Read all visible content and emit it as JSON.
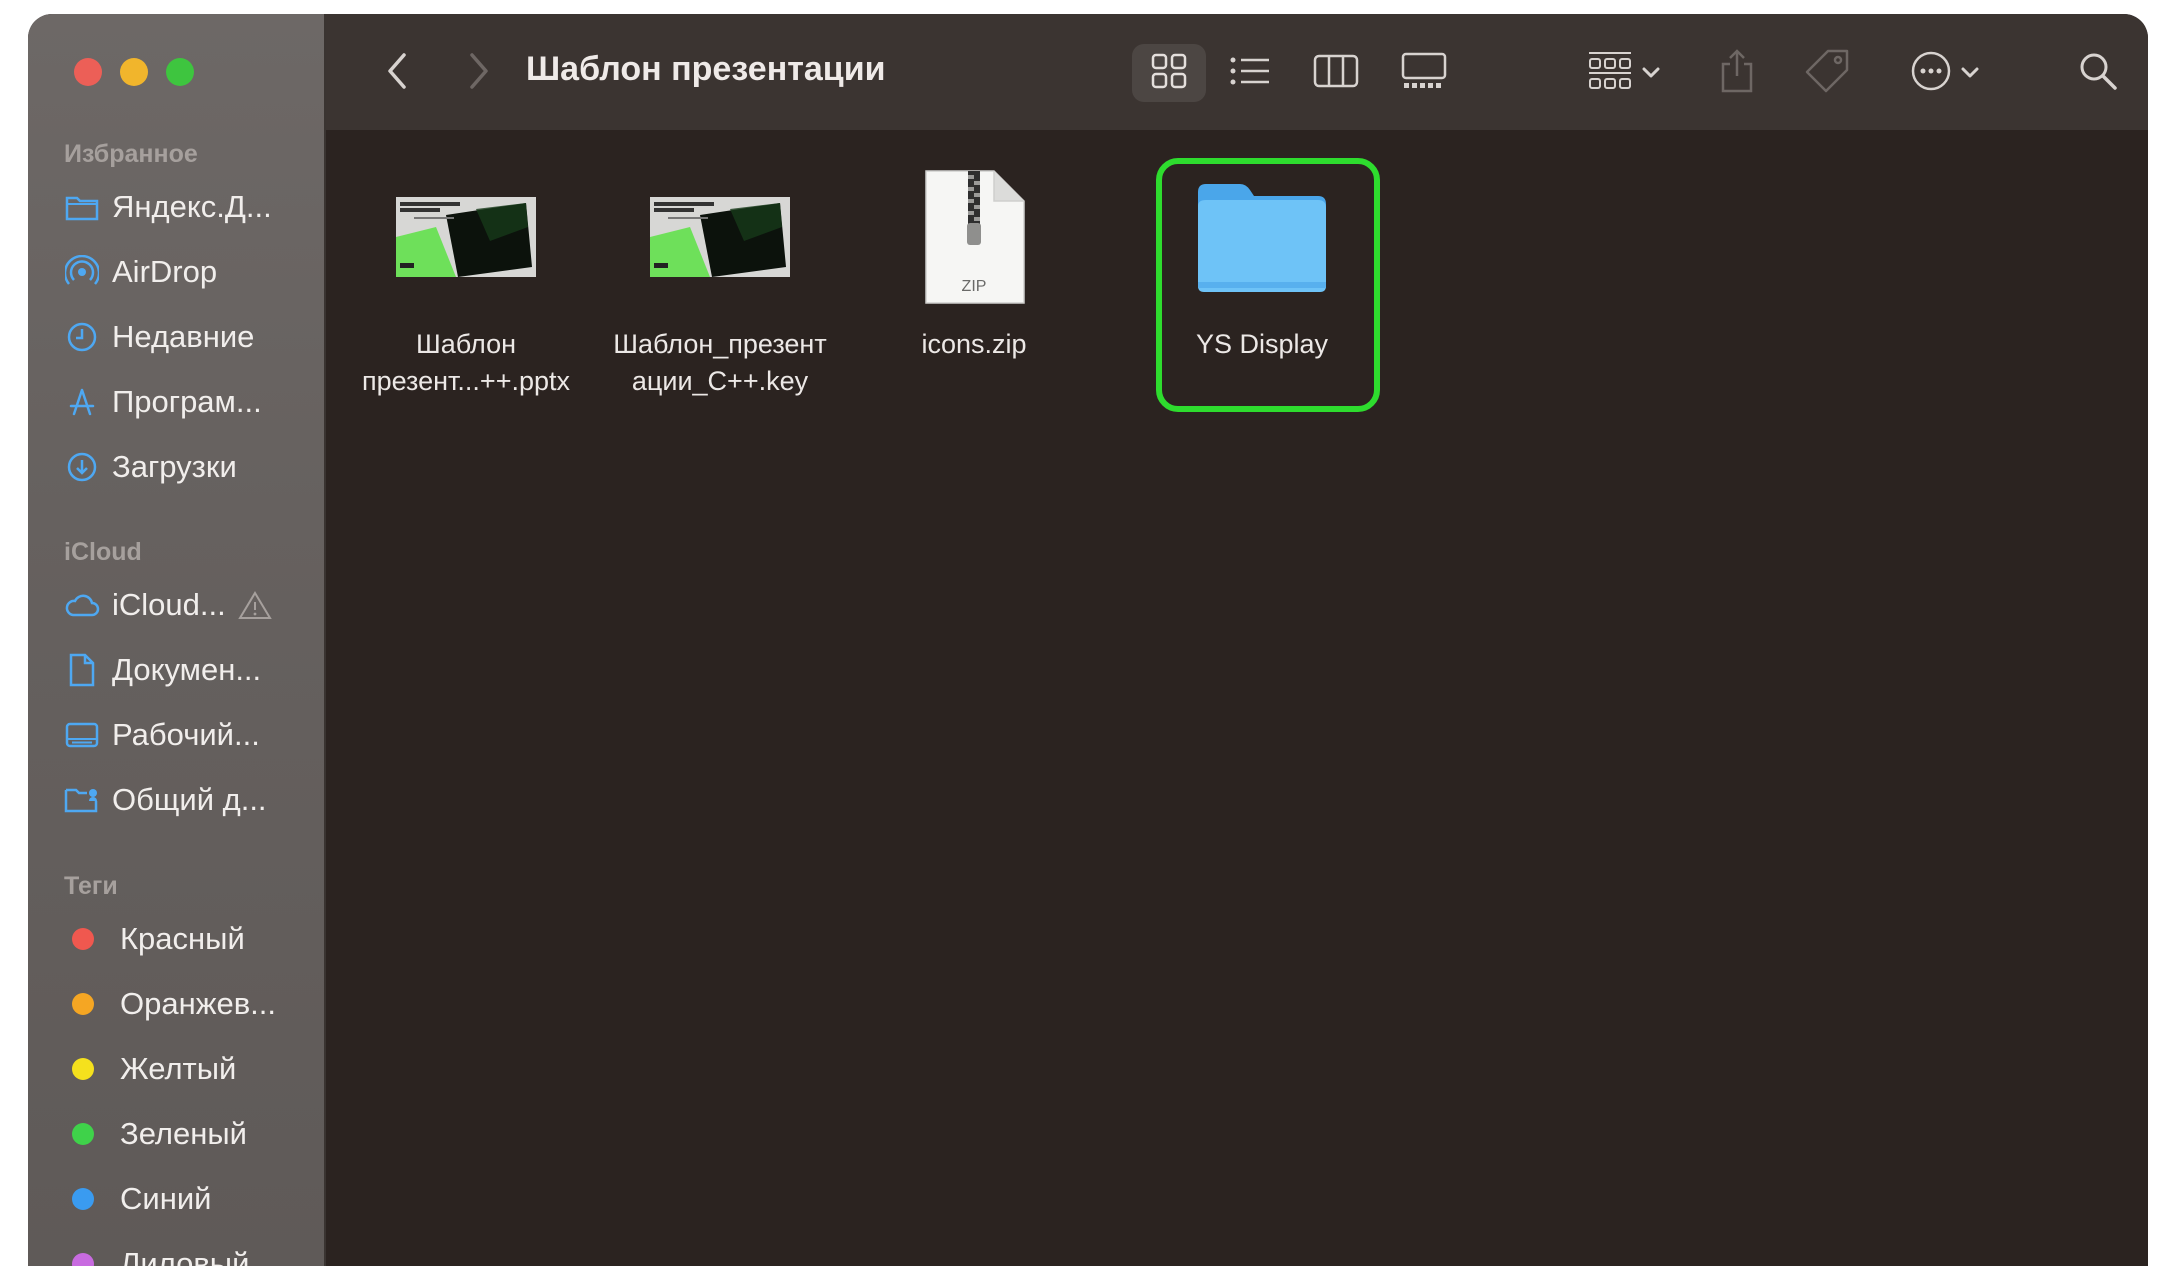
{
  "window": {
    "title": "Шаблон презентации"
  },
  "sidebar": {
    "sections": [
      {
        "label": "Избранное"
      },
      {
        "label": "iCloud"
      },
      {
        "label": "Теги"
      }
    ],
    "favorites": [
      {
        "label": "Яндекс.Д...",
        "icon": "folder-icon"
      },
      {
        "label": "AirDrop",
        "icon": "airdrop-icon"
      },
      {
        "label": "Недавние",
        "icon": "clock-icon"
      },
      {
        "label": "Програм...",
        "icon": "apps-icon"
      },
      {
        "label": "Загрузки",
        "icon": "download-icon"
      }
    ],
    "icloud": [
      {
        "label": "iCloud...",
        "icon": "cloud-icon"
      },
      {
        "label": "Докумен...",
        "icon": "document-icon"
      },
      {
        "label": "Рабочий...",
        "icon": "desktop-icon"
      },
      {
        "label": "Общий д...",
        "icon": "shared-folder-icon"
      }
    ],
    "tags": [
      {
        "label": "Красный",
        "color": "#f0584f"
      },
      {
        "label": "Оранжев...",
        "color": "#f5a623"
      },
      {
        "label": "Желтый",
        "color": "#f5e11d"
      },
      {
        "label": "Зеленый",
        "color": "#3fd24a"
      },
      {
        "label": "Синий",
        "color": "#3a9bf0"
      },
      {
        "label": "Лиловый",
        "color": "#c86be0"
      }
    ]
  },
  "files": [
    {
      "line1": "Шаблон",
      "line2": "презент...++.pptx",
      "type": "pptx-thumbnail"
    },
    {
      "line1": "Шаблон_презент",
      "line2": "ации_C++.key",
      "type": "key-thumbnail"
    },
    {
      "line1": "icons.zip",
      "line2": "",
      "type": "zip",
      "badge": "ZIP"
    },
    {
      "line1": "YS Display",
      "line2": "",
      "type": "folder",
      "selected": true
    }
  ],
  "colors": {
    "accent_selection": "#2edc2e",
    "folder_blue": "#6ec3f7"
  }
}
